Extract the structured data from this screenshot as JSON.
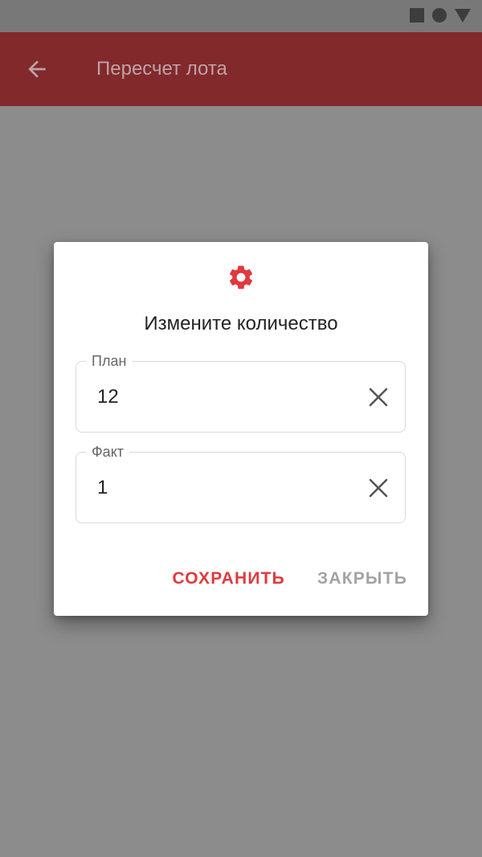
{
  "colors": {
    "accent": "#e0393e",
    "app_bar": "#82292c",
    "scrim": "#8c8c8c"
  },
  "status_bar": {
    "icons": [
      "stop-square-icon",
      "record-circle-icon",
      "signal-triangle-icon"
    ]
  },
  "app_bar": {
    "back_icon": "arrow-left-icon",
    "title": "Пересчет лота"
  },
  "dialog": {
    "icon": "gear-icon",
    "title": "Измените количество",
    "fields": [
      {
        "label": "План",
        "value": "12",
        "clear_icon": "close-icon"
      },
      {
        "label": "Факт",
        "value": "1",
        "clear_icon": "close-icon"
      }
    ],
    "actions": {
      "save_label": "СОХРАНИТЬ",
      "close_label": "ЗАКРЫТЬ"
    }
  }
}
